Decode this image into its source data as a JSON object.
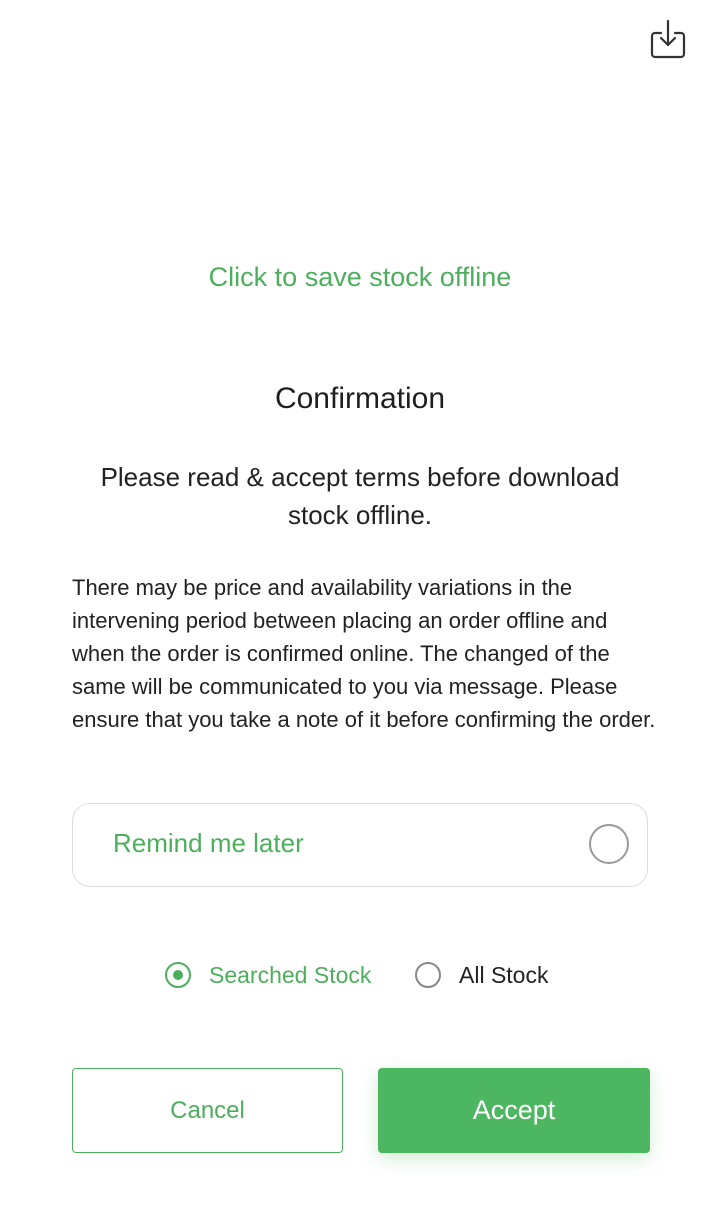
{
  "header": {
    "download_icon": "download-tray-icon"
  },
  "save_offline_link": "Click to save stock offline",
  "dialog": {
    "title": "Confirmation",
    "subtitle": "Please read & accept terms before download stock offline.",
    "body": "There may be price and availability variations in the intervening period between placing an order offline and when the order is confirmed online. The changed of the same will be communicated to you via message. Please ensure that you take a note of it before confirming the order.",
    "remind_label": "Remind me later",
    "remind_checked": false,
    "stock_options": [
      {
        "label": "Searched Stock",
        "selected": true
      },
      {
        "label": "All Stock",
        "selected": false
      }
    ],
    "cancel_label": "Cancel",
    "accept_label": "Accept"
  },
  "colors": {
    "accent": "#4caf5c",
    "accept_bg": "#4db661",
    "text": "#222222"
  }
}
